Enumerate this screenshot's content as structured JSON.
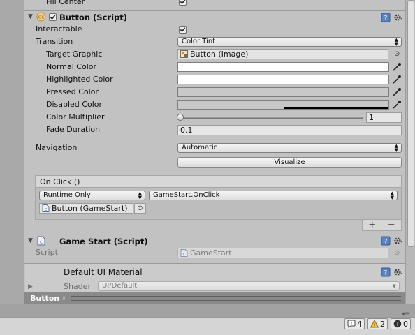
{
  "top": {
    "fill_center_label": "Fill Center",
    "fill_center_checked": true
  },
  "button_component": {
    "title": "Button (Script)",
    "enabled": true,
    "interactable_label": "Interactable",
    "interactable_checked": true,
    "transition_label": "Transition",
    "transition_value": "Color Tint",
    "target_graphic_label": "Target Graphic",
    "target_graphic_value": "Button (Image)",
    "normal_color_label": "Normal Color",
    "highlighted_color_label": "Highlighted Color",
    "pressed_color_label": "Pressed Color",
    "disabled_color_label": "Disabled Color",
    "color_multiplier_label": "Color Multiplier",
    "color_multiplier_value": "1",
    "fade_duration_label": "Fade Duration",
    "fade_duration_value": "0.1",
    "navigation_label": "Navigation",
    "navigation_value": "Automatic",
    "visualize_label": "Visualize",
    "onclick_header": "On Click ()",
    "runtime_value": "Runtime Only",
    "function_value": "GameStart.OnClick",
    "target_object_value": "Button (GameStart)",
    "add_label": "+",
    "remove_label": "−"
  },
  "colors": {
    "normal": "#ffffff",
    "highlighted": "#ffffff",
    "pressed": "#c8c8c8",
    "disabled": "#c8c8c8"
  },
  "gamestart_component": {
    "title": "Game Start (Script)",
    "script_label": "Script",
    "script_value": "GameStart"
  },
  "material": {
    "title": "Default UI Material",
    "shader_label": "Shader",
    "shader_value": "UI/Default"
  },
  "preview_bar": {
    "title": "Button"
  },
  "status": {
    "logs": "4",
    "warnings": "2",
    "errors": "0"
  }
}
